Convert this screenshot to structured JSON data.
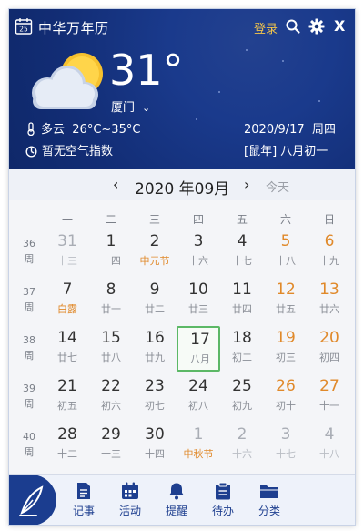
{
  "app": {
    "title": "中华万年历",
    "logo_icon": "calendar-logo-icon",
    "logo_number": "25"
  },
  "titlebar": {
    "login": "登录",
    "search_icon": "search-icon",
    "settings_icon": "gear-icon",
    "close_icon": "close-icon",
    "close_glyph": "X"
  },
  "weather": {
    "icon": "partly-cloudy-icon",
    "temperature": "31°",
    "city": "厦门",
    "condition": "多云",
    "temp_range": "26°C~35°C",
    "air_quality": "暂无空气指数",
    "date": "2020/9/17",
    "weekday": "周四",
    "lunar_date": "[鼠年] 八月初一"
  },
  "calendar": {
    "prev": "‹",
    "next": "›",
    "month_label": "2020 年09月",
    "today_label": "今天",
    "weekday_headers": [
      "一",
      "二",
      "三",
      "四",
      "五",
      "六",
      "日"
    ],
    "weeks": [
      {
        "week_no": "36",
        "week_unit": "周",
        "days": [
          {
            "num": "31",
            "lunar": "十三",
            "state": "out"
          },
          {
            "num": "1",
            "lunar": "十四",
            "state": "normal"
          },
          {
            "num": "2",
            "lunar": "中元节",
            "state": "festival"
          },
          {
            "num": "3",
            "lunar": "十六",
            "state": "normal"
          },
          {
            "num": "4",
            "lunar": "十七",
            "state": "normal"
          },
          {
            "num": "5",
            "lunar": "十八",
            "state": "weekend"
          },
          {
            "num": "6",
            "lunar": "十九",
            "state": "weekend"
          }
        ]
      },
      {
        "week_no": "37",
        "week_unit": "周",
        "days": [
          {
            "num": "7",
            "lunar": "白露",
            "state": "festival"
          },
          {
            "num": "8",
            "lunar": "廿一",
            "state": "normal"
          },
          {
            "num": "9",
            "lunar": "廿二",
            "state": "normal"
          },
          {
            "num": "10",
            "lunar": "廿三",
            "state": "normal"
          },
          {
            "num": "11",
            "lunar": "廿四",
            "state": "normal"
          },
          {
            "num": "12",
            "lunar": "廿五",
            "state": "weekend"
          },
          {
            "num": "13",
            "lunar": "廿六",
            "state": "weekend"
          }
        ]
      },
      {
        "week_no": "38",
        "week_unit": "周",
        "days": [
          {
            "num": "14",
            "lunar": "廿七",
            "state": "normal"
          },
          {
            "num": "15",
            "lunar": "廿八",
            "state": "normal"
          },
          {
            "num": "16",
            "lunar": "廿九",
            "state": "normal"
          },
          {
            "num": "17",
            "lunar": "八月",
            "state": "today"
          },
          {
            "num": "18",
            "lunar": "初二",
            "state": "normal"
          },
          {
            "num": "19",
            "lunar": "初三",
            "state": "weekend"
          },
          {
            "num": "20",
            "lunar": "初四",
            "state": "weekend"
          }
        ]
      },
      {
        "week_no": "39",
        "week_unit": "周",
        "days": [
          {
            "num": "21",
            "lunar": "初五",
            "state": "normal"
          },
          {
            "num": "22",
            "lunar": "初六",
            "state": "normal"
          },
          {
            "num": "23",
            "lunar": "初七",
            "state": "normal"
          },
          {
            "num": "24",
            "lunar": "初八",
            "state": "normal"
          },
          {
            "num": "25",
            "lunar": "初九",
            "state": "normal"
          },
          {
            "num": "26",
            "lunar": "初十",
            "state": "weekend"
          },
          {
            "num": "27",
            "lunar": "十一",
            "state": "weekend"
          }
        ]
      },
      {
        "week_no": "40",
        "week_unit": "周",
        "days": [
          {
            "num": "28",
            "lunar": "十二",
            "state": "normal"
          },
          {
            "num": "29",
            "lunar": "十三",
            "state": "normal"
          },
          {
            "num": "30",
            "lunar": "十四",
            "state": "normal"
          },
          {
            "num": "1",
            "lunar": "中秋节",
            "state": "out-festival"
          },
          {
            "num": "2",
            "lunar": "十六",
            "state": "out"
          },
          {
            "num": "3",
            "lunar": "十七",
            "state": "out"
          },
          {
            "num": "4",
            "lunar": "十八",
            "state": "out"
          }
        ]
      }
    ]
  },
  "toolbar": {
    "quill_icon": "quill-pen-icon",
    "items": [
      {
        "label": "记事",
        "icon": "note-icon"
      },
      {
        "label": "活动",
        "icon": "activity-calendar-icon"
      },
      {
        "label": "提醒",
        "icon": "bell-icon"
      },
      {
        "label": "待办",
        "icon": "clipboard-icon"
      },
      {
        "label": "分类",
        "icon": "folder-icon"
      }
    ]
  },
  "colors": {
    "header_bg": "#15306f",
    "accent_orange": "#e0892a",
    "today_border": "#5cb866",
    "toolbar_blue": "#1e3f8f",
    "login_gold": "#f5c64a"
  }
}
